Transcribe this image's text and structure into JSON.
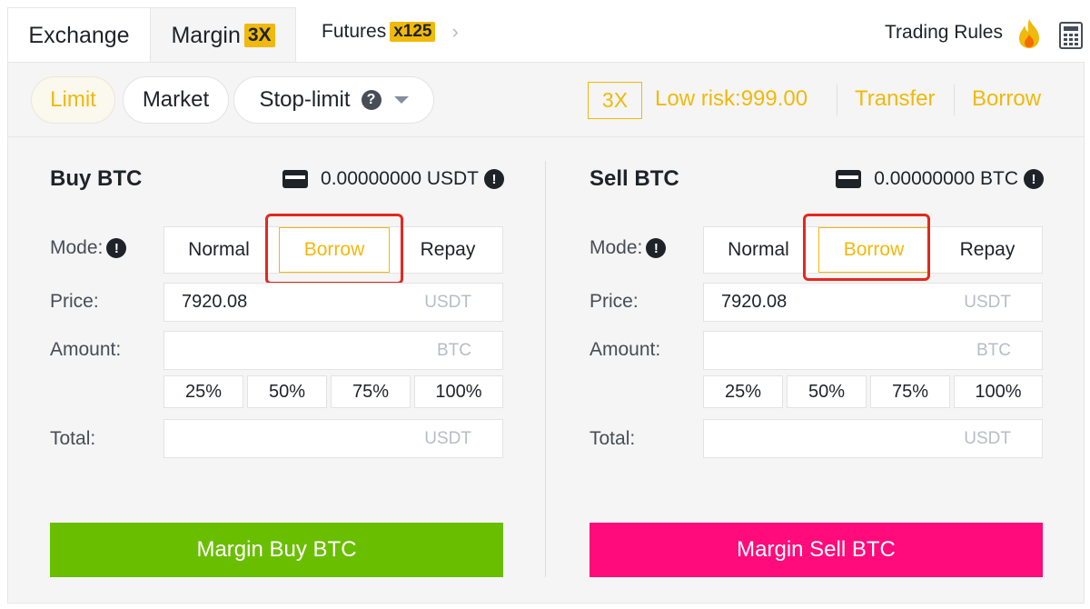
{
  "tabs": [
    {
      "label": "Exchange"
    },
    {
      "label": "Margin",
      "badge": "3X"
    },
    {
      "label": "Futures",
      "badge": "x125"
    }
  ],
  "header": {
    "trading_rules": "Trading Rules",
    "chevron": "›"
  },
  "order_types": [
    {
      "label": "Limit",
      "active": true
    },
    {
      "label": "Market"
    },
    {
      "label": "Stop-limit",
      "help": "?"
    }
  ],
  "margin_info": {
    "leverage": "3X",
    "risk": "Low risk:999.00",
    "transfer": "Transfer",
    "borrow": "Borrow"
  },
  "colors": {
    "accent": "#f0b90b",
    "buy": "#6abe00",
    "sell": "#ff0b7b",
    "highlight": "#e5281d"
  },
  "buy": {
    "title": "Buy BTC",
    "balance": "0.00000000 USDT",
    "mode_label": "Mode:",
    "modes": [
      "Normal",
      "Borrow",
      "Repay"
    ],
    "selected_mode": "Borrow",
    "price_label": "Price:",
    "price_value": "7920.08",
    "price_unit": "USDT",
    "amount_label": "Amount:",
    "amount_unit": "BTC",
    "percents": [
      "25%",
      "50%",
      "75%",
      "100%"
    ],
    "total_label": "Total:",
    "total_unit": "USDT",
    "submit": "Margin Buy BTC"
  },
  "sell": {
    "title": "Sell BTC",
    "balance": "0.00000000 BTC",
    "mode_label": "Mode:",
    "modes": [
      "Normal",
      "Borrow",
      "Repay"
    ],
    "selected_mode": "Borrow",
    "price_label": "Price:",
    "price_value": "7920.08",
    "price_unit": "USDT",
    "amount_label": "Amount:",
    "amount_unit": "BTC",
    "percents": [
      "25%",
      "50%",
      "75%",
      "100%"
    ],
    "total_label": "Total:",
    "total_unit": "USDT",
    "submit": "Margin Sell BTC"
  }
}
